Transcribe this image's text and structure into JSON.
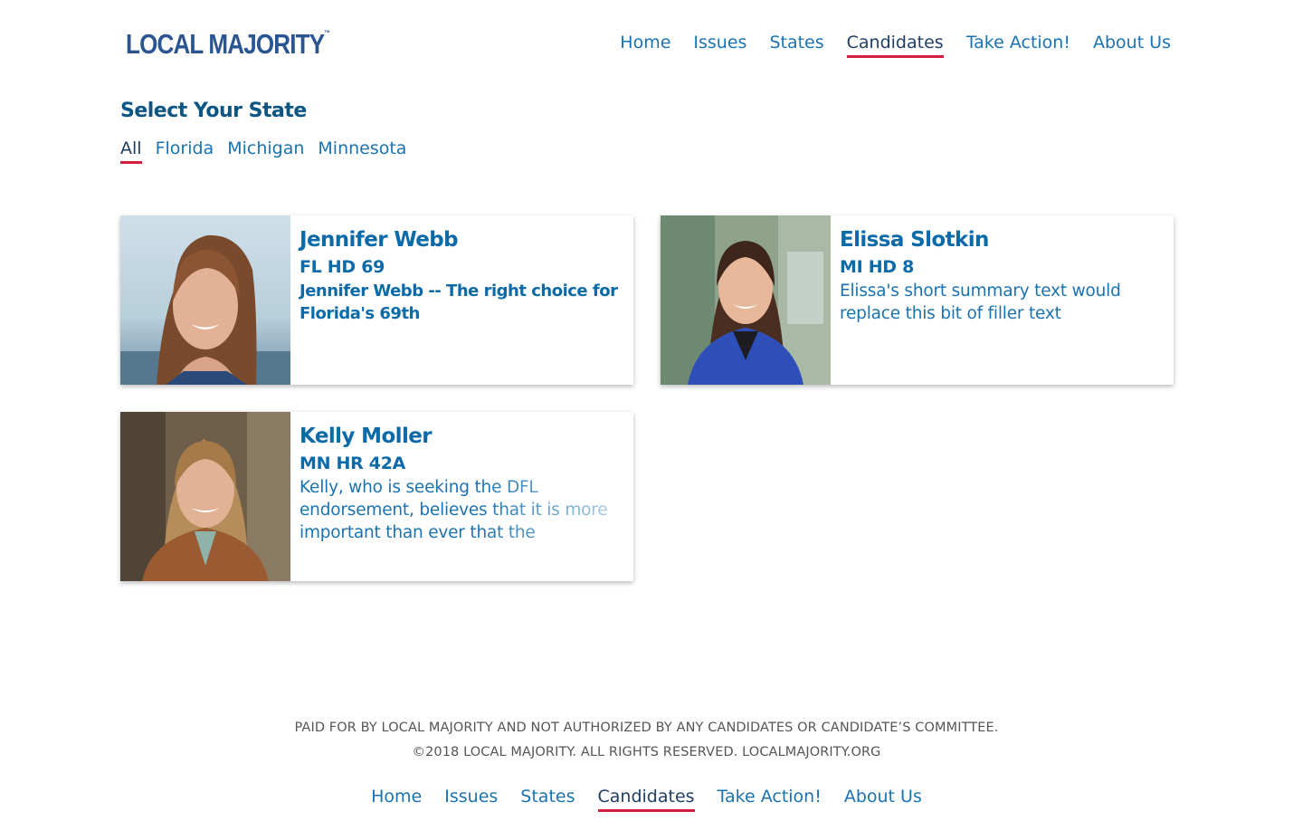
{
  "brand": {
    "name": "LOCAL MAJORITY",
    "tm": "™",
    "navy": "#2a5591",
    "red": "#d41f3c",
    "link_blue": "#1a73b0"
  },
  "header": {
    "nav": [
      {
        "label": "Home"
      },
      {
        "label": "Issues"
      },
      {
        "label": "States"
      },
      {
        "label": "Candidates",
        "active": true
      },
      {
        "label": "Take Action!"
      },
      {
        "label": "About Us"
      }
    ]
  },
  "state_filter": {
    "title": "Select Your State",
    "options": [
      {
        "label": "All",
        "active": true
      },
      {
        "label": "Florida"
      },
      {
        "label": "Michigan"
      },
      {
        "label": "Minnesota"
      }
    ]
  },
  "candidates": [
    {
      "name": "Jennifer Webb",
      "district": "FL HD 69",
      "summary": "Jennifer Webb -- The right choice for Florida's 69th"
    },
    {
      "name": "Elissa Slotkin",
      "district": "MI HD 8",
      "summary": "Elissa's short summary text would replace this bit of filler text"
    },
    {
      "name": "Kelly Moller",
      "district": "MN HR 42A",
      "summary": "Kelly, who is seeking the DFL endorsement, believes that it is more important than ever that the"
    }
  ],
  "footer": {
    "disclaimer": "PAID FOR BY LOCAL MAJORITY AND NOT AUTHORIZED BY ANY CANDIDATES OR CANDIDATE’S COMMITTEE.",
    "copyright": "©2018 LOCAL MAJORITY. ALL RIGHTS RESERVED. LOCALMAJORITY.ORG",
    "nav": [
      {
        "label": "Home"
      },
      {
        "label": "Issues"
      },
      {
        "label": "States"
      },
      {
        "label": "Candidates",
        "active": true
      },
      {
        "label": "Take Action!"
      },
      {
        "label": "About Us"
      }
    ]
  }
}
